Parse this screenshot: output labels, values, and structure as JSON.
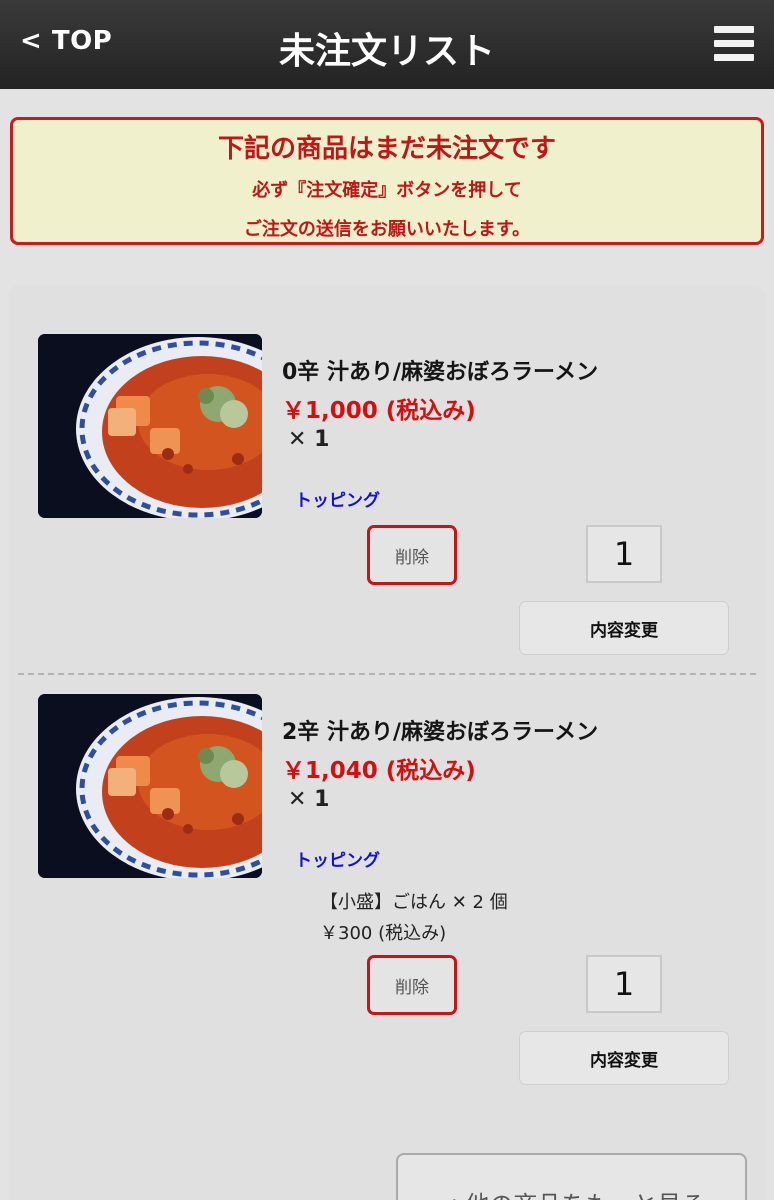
{
  "header": {
    "back_label": "< TOP",
    "title": "未注文リスト",
    "menu_icon": "hamburger-menu-icon"
  },
  "notice": {
    "title": "下記の商品はまだ未注文です",
    "line1": "必ず『注文確定』ボタンを押して",
    "line2": "ご注文の送信をお願いいたします。"
  },
  "items": [
    {
      "name": "0辛 汁あり/麻婆おぼろラーメン",
      "price": "￥1,000 (税込み)",
      "quantity_text": "✕ 1",
      "topping_label": "トッピング",
      "toppings": [],
      "delete_label": "削除",
      "quantity_value": "1",
      "change_label": "内容変更"
    },
    {
      "name": "2辛 汁あり/麻婆おぼろラーメン",
      "price": "￥1,040 (税込み)",
      "quantity_text": "✕ 1",
      "topping_label": "トッピング",
      "toppings": [
        {
          "name_qty": "【小盛】ごはん ✕ 2 個",
          "price": "￥300 (税込み)"
        }
      ],
      "delete_label": "削除",
      "quantity_value": "1",
      "change_label": "内容変更"
    }
  ],
  "more_button": "< 他の商品をもっと見る",
  "colors": {
    "header_bg": "#2b2b2b",
    "notice_bg": "#f0f0cd",
    "accent_red": "#cc1a1a",
    "price_red": "#d21010",
    "topping_blue": "#1010e0"
  }
}
